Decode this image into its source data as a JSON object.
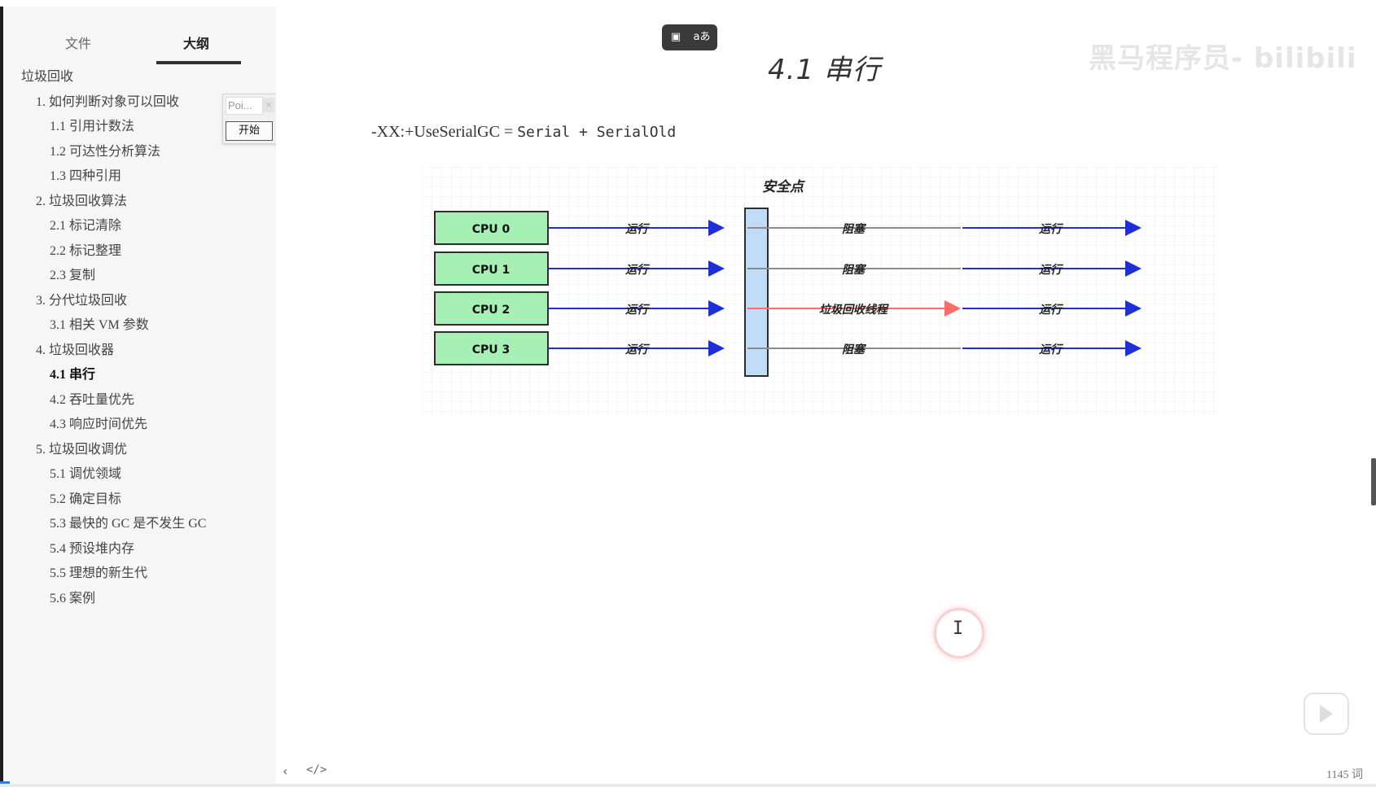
{
  "sidebar": {
    "tabs": [
      {
        "label": "文件"
      },
      {
        "label": "大纲"
      }
    ],
    "outline": [
      {
        "label": "垃圾回收"
      },
      {
        "label": "1. 如何判断对象可以回收"
      },
      {
        "label": "1.1 引用计数法"
      },
      {
        "label": "1.2 可达性分析算法"
      },
      {
        "label": "1.3 四种引用"
      },
      {
        "label": "2. 垃圾回收算法"
      },
      {
        "label": "2.1 标记清除"
      },
      {
        "label": "2.2 标记整理"
      },
      {
        "label": "2.3 复制"
      },
      {
        "label": "3. 分代垃圾回收"
      },
      {
        "label": "3.1 相关 VM 参数"
      },
      {
        "label": "4. 垃圾回收器"
      },
      {
        "label": "4.1 串行"
      },
      {
        "label": "4.2 吞吐量优先"
      },
      {
        "label": "4.3 响应时间优先"
      },
      {
        "label": "5. 垃圾回收调优"
      },
      {
        "label": "5.1 调优领域"
      },
      {
        "label": "5.2 确定目标"
      },
      {
        "label": "5.3 最快的 GC 是不发生 GC"
      },
      {
        "label": "5.4 预设堆内存"
      },
      {
        "label": "5.5 理想的新生代"
      },
      {
        "label": "5.6 案例"
      }
    ],
    "active_index": 12
  },
  "popup": {
    "input_placeholder": "Poi...",
    "close_label": "×",
    "button_label": "开始"
  },
  "toolbar": {
    "icon1": "▣",
    "icon2": "aあ"
  },
  "document": {
    "title": "4.1 串行",
    "code_prefix": "-XX:+UseSerialGC = ",
    "code_mono": "Serial + SerialOld"
  },
  "diagram": {
    "title": "安全点",
    "cpus": [
      "CPU 0",
      "CPU 1",
      "CPU 2",
      "CPU 3"
    ],
    "before_label": "运行",
    "middle_labels": [
      "阻塞",
      "阻塞",
      "垃圾回收线程",
      "阻塞"
    ],
    "after_label": "运行"
  },
  "watermark": "黑马程序员- bilibili",
  "footer": {
    "prev_icon": "‹",
    "code_icon": "</>",
    "word_count": "1145 词"
  },
  "colors": {
    "cpu_fill": "#a6f0b5",
    "cpu_stroke": "#2d2d2d",
    "safepoint_fill": "#c0dcf7",
    "run_arrow": "#1f2fd6",
    "block_line": "#8a8a8a",
    "gc_arrow": "#ff6b6b"
  }
}
